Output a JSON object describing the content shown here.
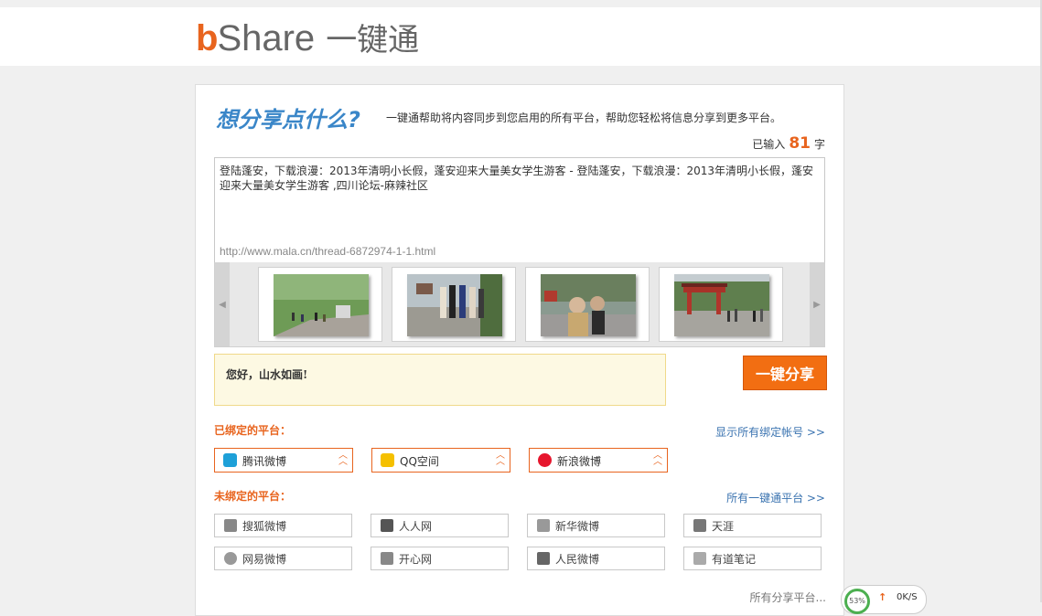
{
  "header": {
    "logo_b": "b",
    "logo_share": "Share",
    "logo_cn": "一键通"
  },
  "compose": {
    "title": "想分享点什么?",
    "description": "一键通帮助将内容同步到您启用的所有平台，帮助您轻松将信息分享到更多平台。",
    "count_prefix": "已输入",
    "count_value": "81",
    "count_suffix": "字",
    "text": "登陆蓬安，下载浪漫：2013年清明小长假，蓬安迎来大量美女学生游客 - 登陆蓬安，下载浪漫：2013年清明小长假，蓬安迎来大量美女学生游客 ,四川论坛-麻辣社区",
    "url": "http://www.mala.cn/thread-6872974-1-1.html"
  },
  "carousel": {
    "left_arrow": "◀",
    "right_arrow": "▶",
    "images": [
      "road-scene",
      "group-photo",
      "selfie-photo",
      "red-gate-photo"
    ]
  },
  "greeting": "您好，山水如画!",
  "share_button": "一键分享",
  "bound_section": {
    "title": "已绑定的平台：",
    "link": "显示所有绑定帐号 >>",
    "items": [
      {
        "label": "腾讯微博",
        "icon": "tencent-weibo-icon",
        "color": "#1ea0d8"
      },
      {
        "label": "QQ空间",
        "icon": "qzone-icon",
        "color": "#f5c000"
      },
      {
        "label": "新浪微博",
        "icon": "sina-weibo-icon",
        "color": "#e6162d"
      }
    ]
  },
  "unbound_section": {
    "title": "未绑定的平台：",
    "link": "所有一键通平台 >>",
    "items": [
      {
        "label": "搜狐微博",
        "icon": "sohu-weibo-icon"
      },
      {
        "label": "人人网",
        "icon": "renren-icon"
      },
      {
        "label": "新华微博",
        "icon": "xinhua-weibo-icon"
      },
      {
        "label": "天涯",
        "icon": "tianya-icon"
      },
      {
        "label": "网易微博",
        "icon": "netease-weibo-icon"
      },
      {
        "label": "开心网",
        "icon": "kaixin-icon"
      },
      {
        "label": "人民微博",
        "icon": "people-weibo-icon"
      },
      {
        "label": "有道笔记",
        "icon": "youdao-note-icon"
      }
    ]
  },
  "more_platforms": "所有分享平台...",
  "speed_widget": {
    "percent": "53%",
    "arrow": "↑",
    "value": "0K/S"
  }
}
